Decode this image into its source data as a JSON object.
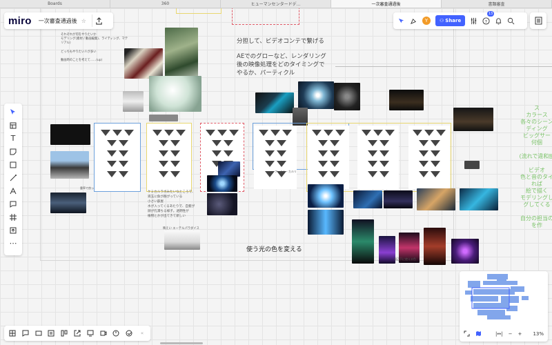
{
  "browser_tabs": [
    "Boards",
    "360",
    "ヒューマンセンタードデ...",
    "一次審査通過後",
    "書類審査"
  ],
  "active_tab": 3,
  "board": {
    "logo": "miro",
    "title": "一次審査通過後"
  },
  "header": {
    "share_label": "Share",
    "avatar_initial": "Y",
    "notification_count": "13"
  },
  "canvas_texts": {
    "split_line1": "分担して、ビデオコンテで繋げる",
    "effects_line": "AEでのグローなど、レンダリング\n後の映像処理をどのタイミングで\nやるか、パーティクル",
    "change_light": "使う光の色を変える",
    "note_top_left": "それぞれが何をやりたいか\nモデリング(素材 / 動画編集)、ライティング、マテリアル)\n\nどっちもやりたい人が多い\n\n動画時のことを考えて……(up)",
    "note_mid": "ケミカルラボみたいなところで、\n液玉に魚が群がっている\n小さい部屋\n水が入ってくるあたりで、自髪が\n顔が孔満ちる様子。透明性が\n植物とかが出てきて新しい",
    "note_bottom": "映えい エーテルパラダイス",
    "note_left_bottom": "重率で良って新しい 小淳い感じ",
    "note_film": "フィルム・カルリ",
    "note_small_bottom": "周辺下に使える色",
    "right_green": "ス\nカラース\n各々のシーン\nディング\nビッグサー\n何個\n\n(流れで違和感\n\nビデオ\n色と音のタイ\nれば\n絵で描く\nモデリングし\nグしてくる\n\n自分の担当の\nを作"
  },
  "minimap": {
    "zoom": "13%"
  },
  "colors": {
    "accent": "#4262ff",
    "avatar": "#f29b28",
    "minimap_block": "#6d97e8",
    "green_note": "#7cc36a"
  },
  "icons": {
    "toolbar": [
      "cursor-icon",
      "template-icon",
      "text-icon",
      "sticky-note-icon",
      "shape-icon",
      "pen-icon",
      "connector-icon",
      "comment-icon",
      "frame-icon",
      "upload-icon",
      "more-icon"
    ],
    "bottombar": [
      "board-icon",
      "sticky-icon",
      "comment-icon",
      "card-icon",
      "kanban-icon",
      "external-icon",
      "screen-icon",
      "video-icon",
      "timer-icon",
      "vote-icon",
      "collapse-icon"
    ]
  }
}
